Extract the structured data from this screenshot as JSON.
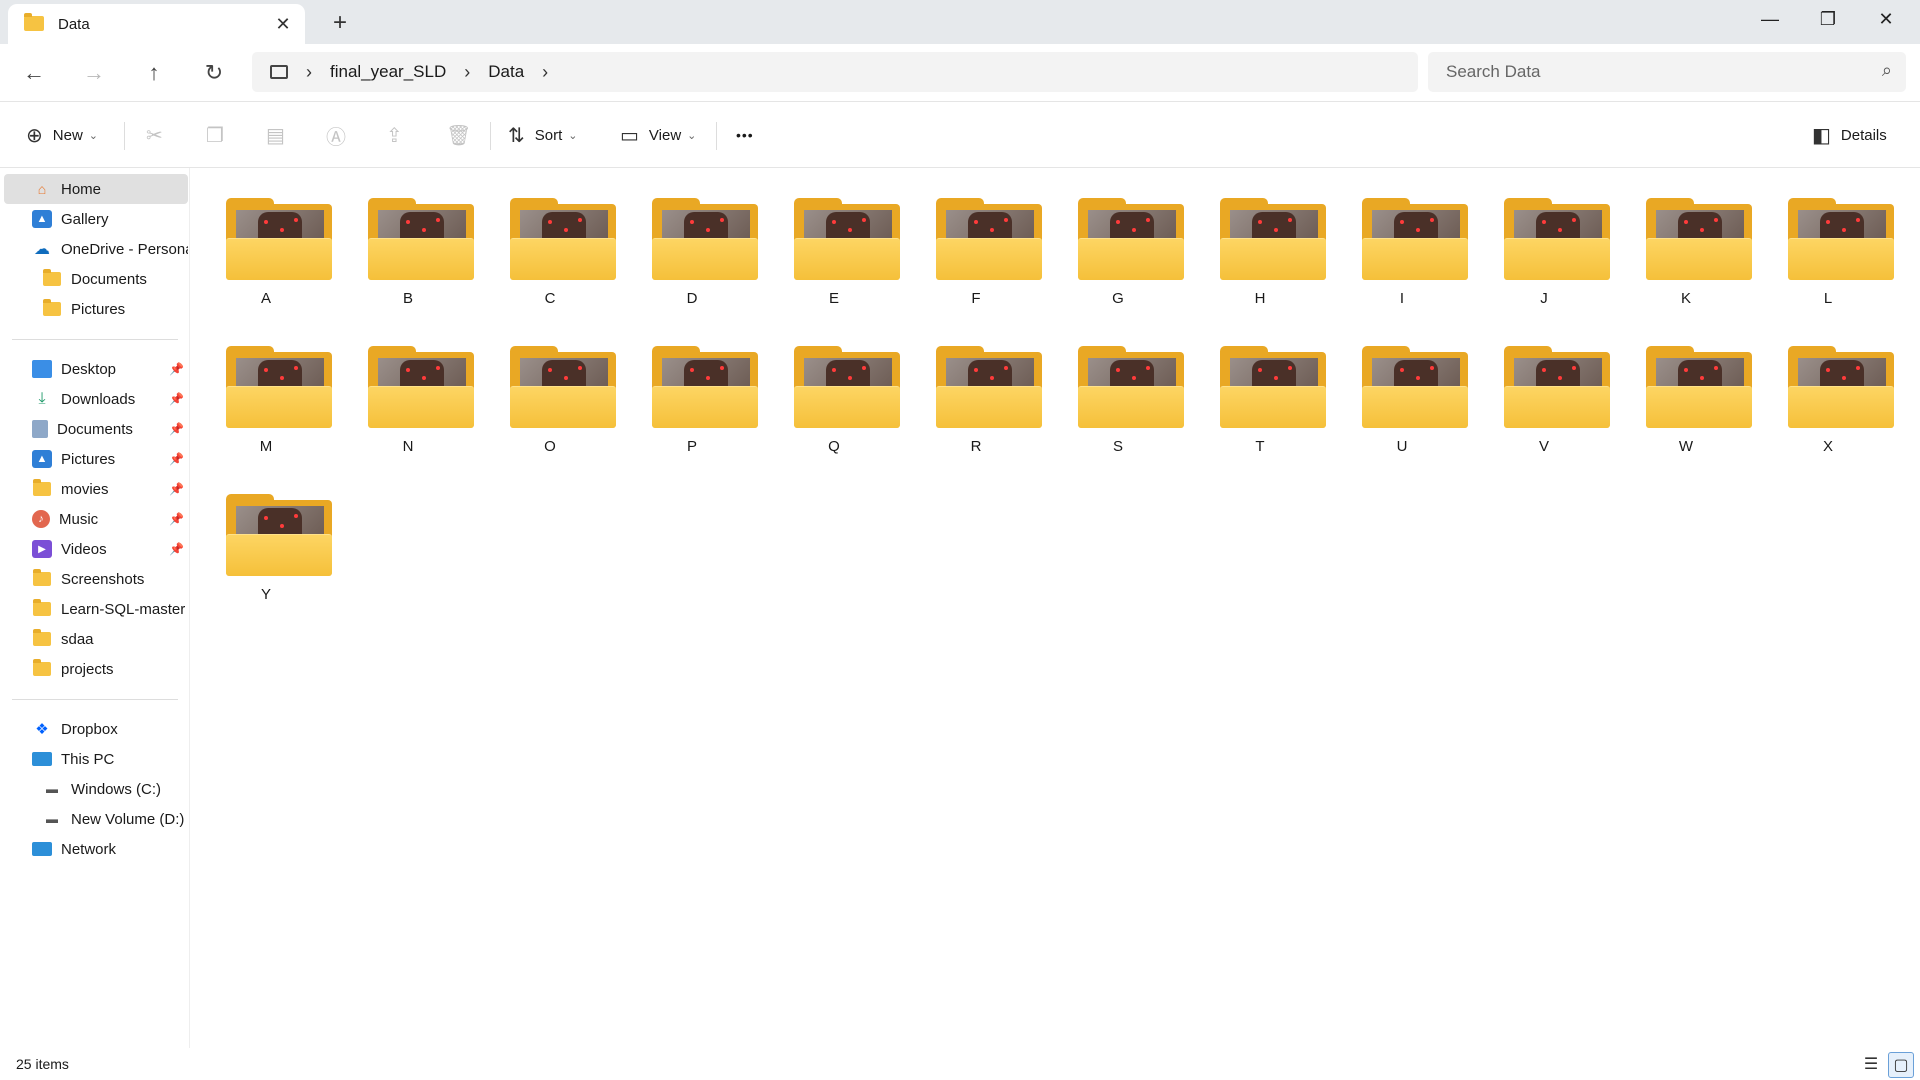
{
  "window": {
    "tab_title": "Data",
    "tab_close": "✕",
    "new_tab": "+",
    "minimize": "—",
    "restore": "❐",
    "close": "✕"
  },
  "nav": {
    "back": "←",
    "forward": "→",
    "up": "↑",
    "refresh": "↻"
  },
  "address": {
    "root_icon": "pc-icon",
    "segments": [
      "final_year_SLD",
      "Data"
    ],
    "sep": "›"
  },
  "search": {
    "placeholder": "Search Data",
    "icon": "⌕"
  },
  "commands": {
    "new": "New",
    "sort": "Sort",
    "view": "View",
    "more": "•••",
    "details": "Details"
  },
  "sidebar": {
    "home": "Home",
    "gallery": "Gallery",
    "onedrive": "OneDrive - Personal",
    "od_documents": "Documents",
    "od_pictures": "Pictures",
    "quick": [
      {
        "label": "Desktop",
        "pinned": true
      },
      {
        "label": "Downloads",
        "pinned": true
      },
      {
        "label": "Documents",
        "pinned": true
      },
      {
        "label": "Pictures",
        "pinned": true
      },
      {
        "label": "movies",
        "pinned": true
      },
      {
        "label": "Music",
        "pinned": true
      },
      {
        "label": "Videos",
        "pinned": true
      },
      {
        "label": "Screenshots",
        "pinned": false
      },
      {
        "label": "Learn-SQL-master",
        "pinned": false
      },
      {
        "label": "sdaa",
        "pinned": false
      },
      {
        "label": "projects",
        "pinned": false
      }
    ],
    "dropbox": "Dropbox",
    "thispc": "This PC",
    "drive_c": "Windows (C:)",
    "drive_d": "New Volume (D:)",
    "network": "Network"
  },
  "folders": [
    "A",
    "B",
    "C",
    "D",
    "E",
    "F",
    "G",
    "H",
    "I",
    "J",
    "K",
    "L",
    "M",
    "N",
    "O",
    "P",
    "Q",
    "R",
    "S",
    "T",
    "U",
    "V",
    "W",
    "X",
    "Y"
  ],
  "status": {
    "count": "25 items"
  },
  "colors": {
    "folder": "#f5c03a",
    "selected": "#e0e0e0",
    "accent": "#0067c0"
  }
}
